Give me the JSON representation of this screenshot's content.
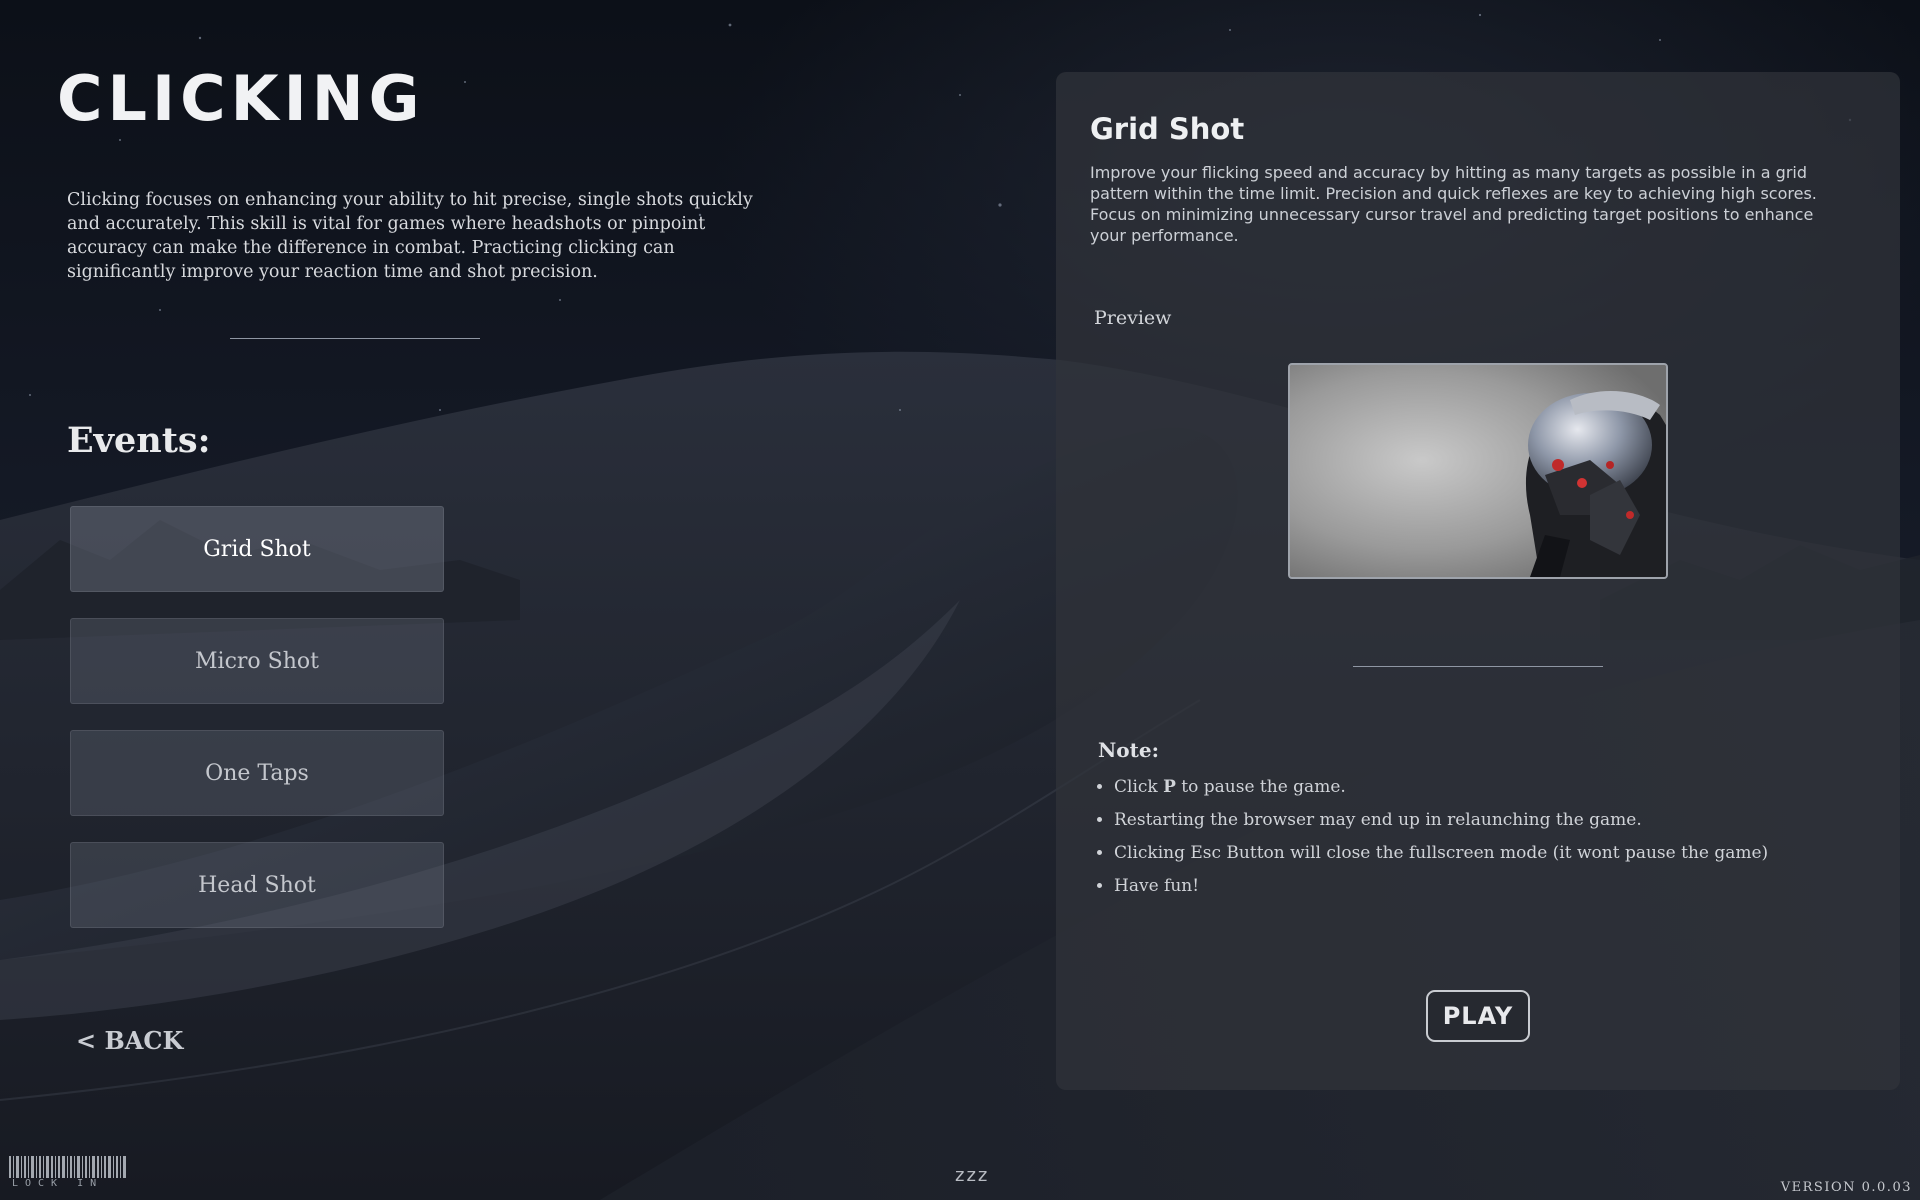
{
  "page": {
    "title": "CLICKING",
    "intro": "Clicking focuses on enhancing your ability to hit precise, single shots quickly and accurately. This skill is vital for games where headshots or pinpoint accuracy can make the difference in combat. Practicing clicking can significantly improve your reaction time and shot precision."
  },
  "events": {
    "heading": "Events:",
    "items": [
      {
        "label": "Grid Shot",
        "active": true
      },
      {
        "label": "Micro Shot",
        "active": false
      },
      {
        "label": "One Taps",
        "active": false
      },
      {
        "label": "Head Shot",
        "active": false
      }
    ]
  },
  "back_label": "< BACK",
  "detail": {
    "title": "Grid Shot",
    "description": "Improve your flicking speed and accuracy by hitting as many targets as possible in a grid pattern within the time limit. Precision and quick reflexes are key to achieving high scores. Focus on minimizing unnecessary cursor travel and predicting target positions to enhance your performance.",
    "preview_label": "Preview",
    "note_heading": "Note:",
    "notes": [
      {
        "before": "Click ",
        "key": "P",
        "after": " to pause the game."
      },
      {
        "before": "Restarting the browser may end up in relaunching the game.",
        "key": "",
        "after": ""
      },
      {
        "before": "Clicking Esc Button will close the fullscreen mode (it wont pause the game)",
        "key": "",
        "after": ""
      },
      {
        "before": "Have fun!",
        "key": "",
        "after": ""
      }
    ],
    "play_label": "PLAY"
  },
  "footer": {
    "logo_text": "LOCK IN",
    "sleep": "zzz",
    "version": "VERSION 0.0.03"
  }
}
